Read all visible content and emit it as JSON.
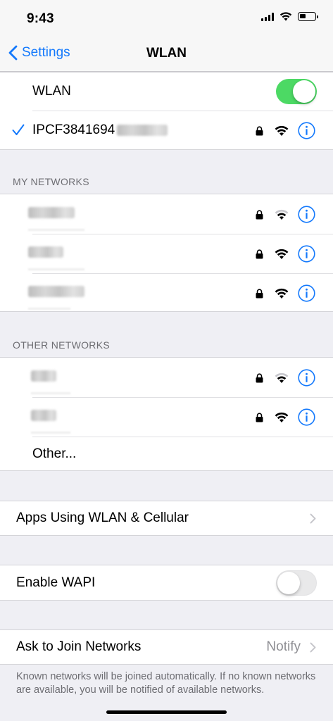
{
  "status_bar": {
    "time": "9:43"
  },
  "nav": {
    "back_label": "Settings",
    "title": "WLAN"
  },
  "wlan_toggle": {
    "label": "WLAN",
    "state": "on"
  },
  "connected_network": {
    "name": "IPCF3841694",
    "secured": true
  },
  "my_networks": {
    "header": "MY NETWORKS",
    "items": [
      {
        "name_hidden": true,
        "secured": true,
        "signal": "medium"
      },
      {
        "name_hidden": true,
        "secured": true,
        "signal": "full"
      },
      {
        "name_hidden": true,
        "secured": true,
        "signal": "full"
      }
    ]
  },
  "other_networks": {
    "header": "OTHER NETWORKS",
    "items": [
      {
        "name_hidden": true,
        "secured": true,
        "signal": "medium"
      },
      {
        "name_hidden": true,
        "secured": true,
        "signal": "full"
      }
    ],
    "other_label": "Other..."
  },
  "apps_using": {
    "label": "Apps Using WLAN & Cellular"
  },
  "enable_wapi": {
    "label": "Enable WAPI",
    "state": "off"
  },
  "ask_to_join": {
    "label": "Ask to Join Networks",
    "value": "Notify",
    "footer": "Known networks will be joined automatically. If no known networks are available, you will be notified of available networks."
  },
  "colors": {
    "accent": "#1479fc",
    "toggle_on": "#4cd964",
    "background": "#efeff4"
  }
}
